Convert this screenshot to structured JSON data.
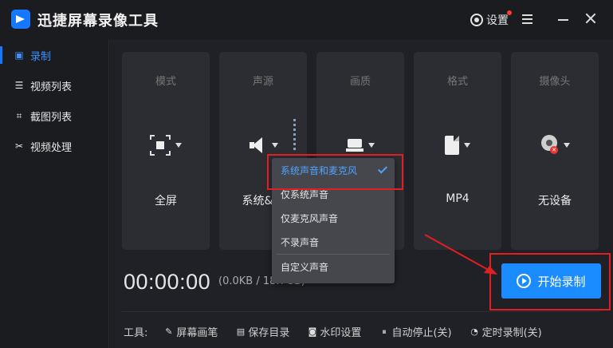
{
  "app": {
    "title": "迅捷屏幕录像工具",
    "settings_label": "设置"
  },
  "sidebar": {
    "items": [
      {
        "label": "录制",
        "icon": "camera-record-icon"
      },
      {
        "label": "视频列表",
        "icon": "list-icon"
      },
      {
        "label": "截图列表",
        "icon": "screenshot-icon"
      },
      {
        "label": "视频处理",
        "icon": "tools-icon"
      }
    ]
  },
  "cards": {
    "mode": {
      "title": "模式",
      "value": "全屏"
    },
    "audio": {
      "title": "声源",
      "value": "系统&麦"
    },
    "quality": {
      "title": "画质",
      "value": ""
    },
    "format": {
      "title": "格式",
      "value": "MP4"
    },
    "camera": {
      "title": "摄像头",
      "value": "无设备"
    }
  },
  "audio_menu": {
    "options": [
      "系统声音和麦克风",
      "仅系统声音",
      "仅麦克风声音",
      "不录声音",
      "自定义声音"
    ],
    "selected": "系统声音和麦克风"
  },
  "status": {
    "timer": "00:00:00",
    "filesize": "(0.0KB / 18.7GB)"
  },
  "start_button": {
    "label": "开始录制"
  },
  "toolbar": {
    "label": "工具:",
    "items": [
      "屏幕画笔",
      "保存目录",
      "水印设置",
      "自动停止(关)",
      "定时录制(关)"
    ]
  },
  "colors": {
    "accent": "#1a8cff",
    "highlight": "#e02020"
  }
}
